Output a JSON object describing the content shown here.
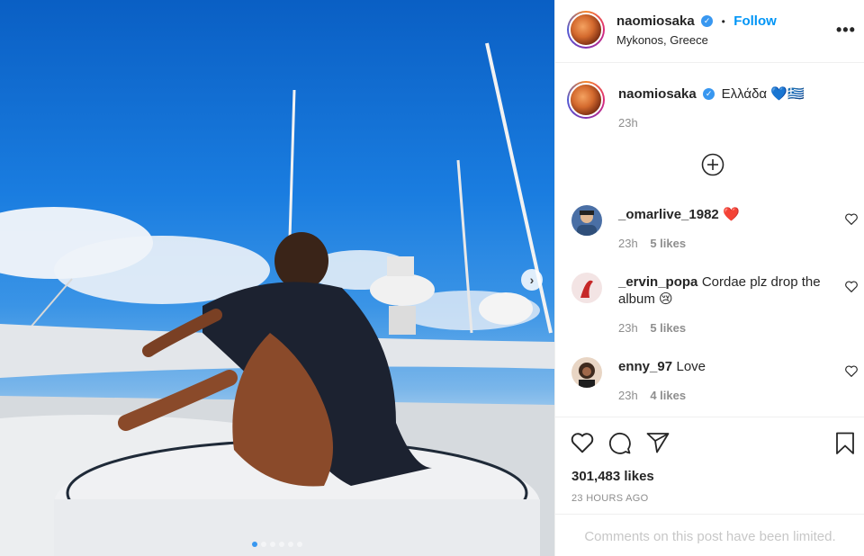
{
  "post": {
    "author": "naomiosaka",
    "follow_label": "Follow",
    "separator": "•",
    "location": "Mykonos, Greece",
    "more_label": "•••",
    "caption_text": "Ελλάδα 💙🇬🇷",
    "caption_time": "23h",
    "load_more_icon": "plus-circle-icon",
    "next_icon_glyph": "›",
    "carousel": {
      "total": 6,
      "active_index": 0
    }
  },
  "comments": [
    {
      "user": "_omarlive_1982",
      "text": "❤️",
      "time": "23h",
      "likes": "5 likes",
      "avatar_color": "#4a6fa5"
    },
    {
      "user": "_ervin_popa",
      "text": "Cordae plz drop the album 😢",
      "time": "23h",
      "likes": "5 likes",
      "avatar_color": "#c62828"
    },
    {
      "user": "enny_97",
      "text": "Love",
      "time": "23h",
      "likes": "4 likes",
      "avatar_color": "#5d4037"
    }
  ],
  "footer": {
    "likes_count": "301,483 likes",
    "time_ago": "23 HOURS AGO",
    "comments_limited": "Comments on this post have been limited."
  },
  "colors": {
    "accent": "#0095f6",
    "verified": "#3897f0",
    "muted": "#8e8e8e"
  }
}
